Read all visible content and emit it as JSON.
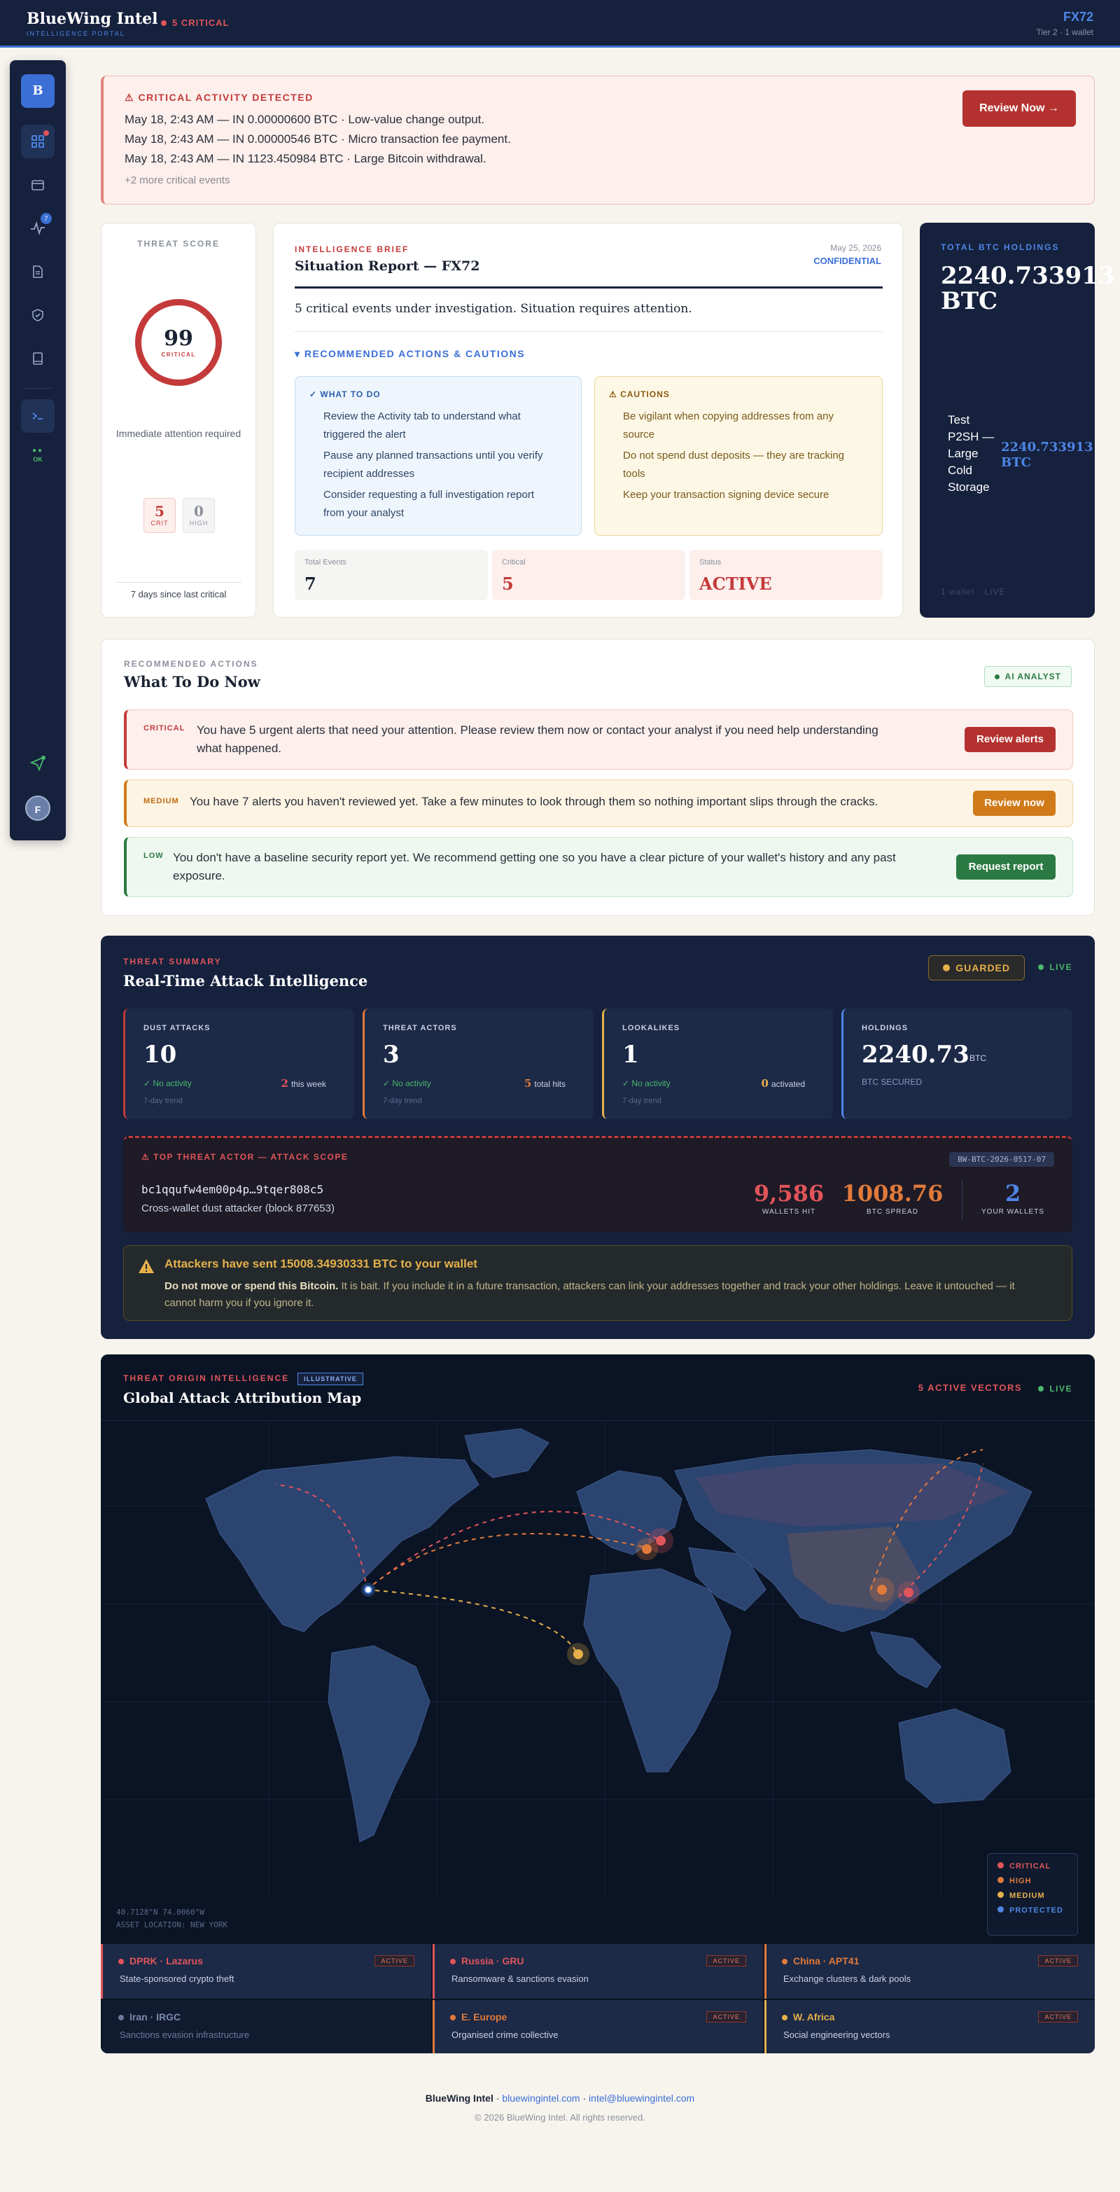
{
  "header": {
    "brand": "BlueWing Intel",
    "brand_sub": "INTELLIGENCE PORTAL",
    "critical_pill": "5 CRITICAL",
    "user_id": "FX72",
    "user_sub": "Tier 2 · 1 wallet"
  },
  "sidebar": {
    "logo": "B",
    "items": [
      {
        "icon": "dashboard-icon",
        "active": true,
        "dot": true
      },
      {
        "icon": "wallet-icon"
      },
      {
        "icon": "activity-icon",
        "badge": "7"
      },
      {
        "icon": "document-icon"
      },
      {
        "icon": "shield-icon"
      },
      {
        "icon": "book-icon"
      },
      {
        "icon": "terminal-icon"
      }
    ],
    "status_ok": "OK",
    "avatar": "F"
  },
  "alert": {
    "title": "⚠ CRITICAL ACTIVITY DETECTED",
    "lines": [
      "May 18, 2:43 AM — IN 0.00000600 BTC · Low-value change output.",
      "May 18, 2:43 AM — IN 0.00000546 BTC · Micro transaction fee payment.",
      "May 18, 2:43 AM — IN 1123.450984 BTC · Large Bitcoin withdrawal."
    ],
    "more": "+2 more critical events",
    "button": "Review Now →"
  },
  "threat_score": {
    "label": "THREAT SCORE",
    "value": "99",
    "level": "CRITICAL",
    "desc": "Immediate attention required",
    "crit_count": "5",
    "crit_label": "CRIT",
    "high_count": "0",
    "high_label": "HIGH",
    "footer": "7 days since last critical"
  },
  "brief": {
    "tag": "INTELLIGENCE BRIEF",
    "title": "Situation Report — FX72",
    "date": "May 25, 2026",
    "classification": "CONFIDENTIAL",
    "summary": "5 critical events under investigation. Situation requires attention.",
    "toggle": "▾ RECOMMENDED ACTIONS & CAUTIONS",
    "todo_title": "✓ WHAT TO DO",
    "todo": [
      "Review the Activity tab to understand what triggered the alert",
      "Pause any planned transactions until you verify recipient addresses",
      "Consider requesting a full investigation report from your analyst"
    ],
    "cautions_title": "⚠ CAUTIONS",
    "cautions": [
      "Be vigilant when copying addresses from any source",
      "Do not spend dust deposits — they are tracking tools",
      "Keep your transaction signing device secure"
    ],
    "stats": [
      {
        "label": "Total Events",
        "value": "7"
      },
      {
        "label": "Critical",
        "value": "5"
      },
      {
        "label": "Status",
        "value": "ACTIVE"
      }
    ]
  },
  "holdings": {
    "label": "TOTAL BTC HOLDINGS",
    "value": "2240.733913 BTC",
    "wallet_name": "Test P2SH — Large Cold Storage",
    "wallet_value": "2240.733913 BTC",
    "footer": "1 wallet · LIVE"
  },
  "recommendations": {
    "tag": "RECOMMENDED ACTIONS",
    "title": "What To Do Now",
    "badge": "AI ANALYST",
    "items": [
      {
        "level": "CRITICAL",
        "text": "You have 5 urgent alerts that need your attention. Please review them now or contact your analyst if you need help understanding what happened.",
        "button": "Review alerts"
      },
      {
        "level": "MEDIUM",
        "text": "You have 7 alerts you haven't reviewed yet. Take a few minutes to look through them so nothing important slips through the cracks.",
        "button": "Review now"
      },
      {
        "level": "LOW",
        "text": "You don't have a baseline security report yet. We recommend getting one so you have a clear picture of your wallet's history and any past exposure.",
        "button": "Request report"
      }
    ]
  },
  "summary": {
    "tag": "THREAT SUMMARY",
    "title": "Real-Time Attack Intelligence",
    "guarded": "GUARDED",
    "live": "LIVE",
    "cards": [
      {
        "label": "DUST ATTACKS",
        "value": "10",
        "ok": "✓ No activity",
        "right_num": "2",
        "right_txt": "this week",
        "trend": "7-day trend"
      },
      {
        "label": "THREAT ACTORS",
        "value": "3",
        "ok": "✓ No activity",
        "right_num": "5",
        "right_txt": "total hits",
        "trend": "7-day trend"
      },
      {
        "label": "LOOKALIKES",
        "value": "1",
        "ok": "✓ No activity",
        "right_num": "0",
        "right_txt": "activated",
        "trend": "7-day trend"
      },
      {
        "label": "HOLDINGS",
        "value": "2240.73",
        "unit": "BTC",
        "sub": "BTC SECURED"
      }
    ],
    "actor": {
      "tag": "⚠ TOP THREAT ACTOR — ATTACK SCOPE",
      "address": "bc1qqufw4em00p4p…9tqer808c5",
      "desc": "Cross-wallet dust attacker (block 877653)",
      "case_id": "BW-BTC-2026-0517-07",
      "wallets_hit": "9,586",
      "wallets_hit_label": "WALLETS HIT",
      "btc_spread": "1008.76",
      "btc_spread_label": "BTC SPREAD",
      "your_wallets": "2",
      "your_wallets_label": "YOUR WALLETS"
    },
    "warning": {
      "title": "Attackers have sent 15008.34930331 BTC to your wallet",
      "bold": "Do not move or spend this Bitcoin.",
      "text": " It is bait. If you include it in a future transaction, attackers can link your addresses together and track your other holdings. Leave it untouched — it cannot harm you if you ignore it."
    }
  },
  "map": {
    "tag": "THREAT ORIGIN INTELLIGENCE",
    "illustrative": "ILLUSTRATIVE",
    "title": "Global Attack Attribution Map",
    "vectors": "5 ACTIVE VECTORS",
    "live": "LIVE",
    "coords": "40.7128°N 74.0060°W",
    "asset_location": "ASSET LOCATION: NEW YORK",
    "legend": [
      {
        "label": "CRITICAL",
        "color": "#e0555a"
      },
      {
        "label": "HIGH",
        "color": "#e07a3a"
      },
      {
        "label": "MEDIUM",
        "color": "#e5b04a"
      },
      {
        "label": "PROTECTED",
        "color": "#4e86e6"
      }
    ],
    "origins": [
      {
        "name": "DPRK · Lazarus",
        "desc": "State-sponsored crypto theft",
        "status": "ACTIVE",
        "color": "#e0555a"
      },
      {
        "name": "Russia · GRU",
        "desc": "Ransomware & sanctions evasion",
        "status": "ACTIVE",
        "color": "#e0555a"
      },
      {
        "name": "China · APT41",
        "desc": "Exchange clusters & dark pools",
        "status": "ACTIVE",
        "color": "#e07a3a"
      },
      {
        "name": "Iran · IRGC",
        "desc": "Sanctions evasion infrastructure",
        "status": "",
        "color": "#6a7a9c"
      },
      {
        "name": "E. Europe",
        "desc": "Organised crime collective",
        "status": "ACTIVE",
        "color": "#e07a3a"
      },
      {
        "name": "W. Africa",
        "desc": "Social engineering vectors",
        "status": "ACTIVE",
        "color": "#e5b04a"
      }
    ]
  },
  "footer": {
    "brand": "BlueWing Intel",
    "site": "bluewingintel.com",
    "email": "intel@bluewingintel.com",
    "copyright": "© 2026 BlueWing Intel. All rights reserved."
  }
}
